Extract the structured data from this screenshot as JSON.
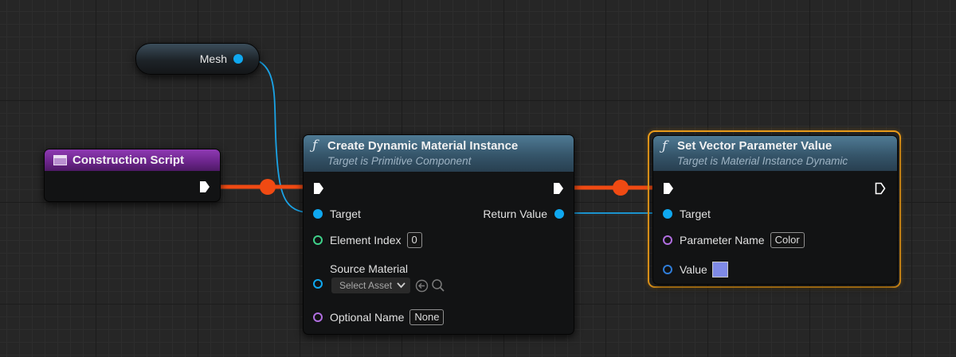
{
  "colors": {
    "exec_wire": "#f04a13",
    "object_wire": "#1aa3e6",
    "selected_outline": "#f2a01b",
    "purple_header": "#7a2a9a",
    "function_header": "#3f6379"
  },
  "mesh_node": {
    "label": "Mesh"
  },
  "construction_node": {
    "title": "Construction Script",
    "icon": "construction-script-icon"
  },
  "create_node": {
    "icon": "function-icon",
    "title": "Create Dynamic Material Instance",
    "subtitle": "Target is Primitive Component",
    "target_label": "Target",
    "return_label": "Return Value",
    "element_index_label": "Element Index",
    "element_index_value": "0",
    "source_material_label": "Source Material",
    "select_asset_label": "Select Asset",
    "optional_name_label": "Optional Name",
    "optional_name_value": "None"
  },
  "set_node": {
    "icon": "function-icon",
    "title": "Set Vector Parameter Value",
    "subtitle": "Target is Material Instance Dynamic",
    "target_label": "Target",
    "param_name_label": "Parameter Name",
    "param_name_value": "Color",
    "value_label": "Value",
    "value_color": "#7f8ae6"
  }
}
